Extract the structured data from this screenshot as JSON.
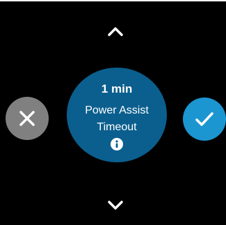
{
  "timeout": {
    "value": "1 min",
    "label_line1": "Power Assist",
    "label_line2": "Timeout"
  },
  "icons": {
    "up": "chevron-up-icon",
    "down": "chevron-down-icon",
    "cancel": "close-icon",
    "confirm": "check-icon",
    "info": "info-icon"
  },
  "colors": {
    "background": "#000000",
    "center_circle": "#0b5f8e",
    "cancel_button": "#808080",
    "confirm_button": "#1b96d1",
    "icon": "#ffffff"
  }
}
